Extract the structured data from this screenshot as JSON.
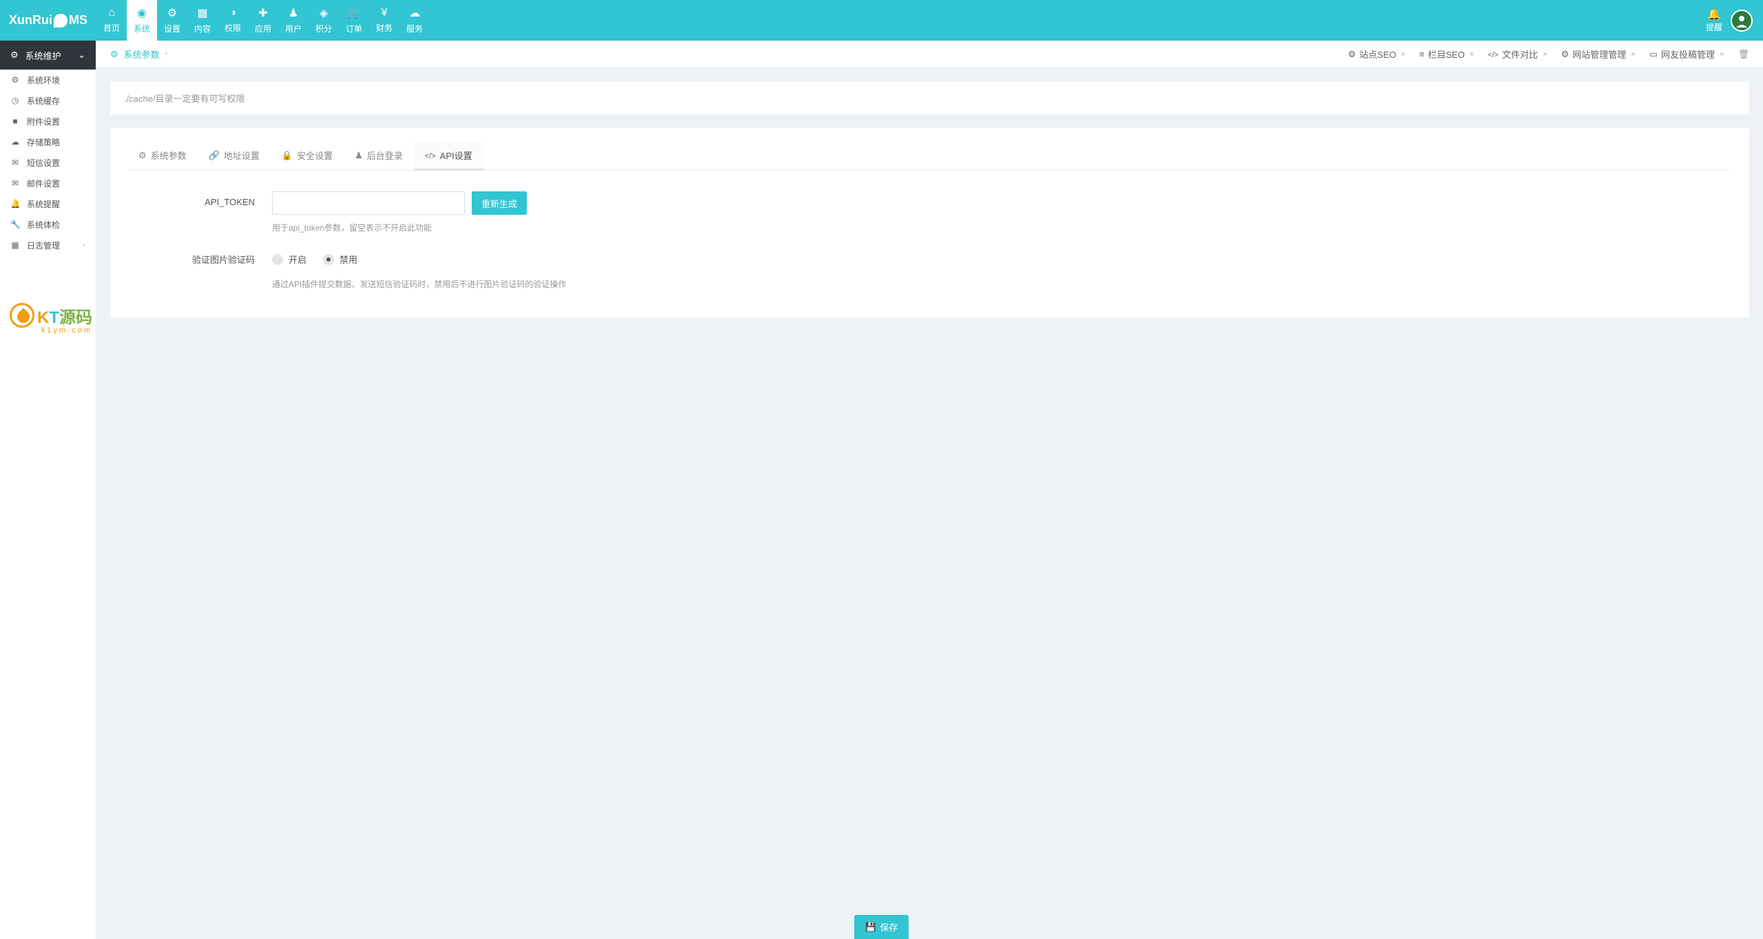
{
  "logo": {
    "prefix": "XunRui",
    "suffix": "MS"
  },
  "topNav": [
    {
      "icon": "i-home",
      "label": "首页"
    },
    {
      "icon": "i-globe",
      "label": "系统",
      "active": true
    },
    {
      "icon": "i-cogs",
      "label": "设置"
    },
    {
      "icon": "i-grid",
      "label": "内容"
    },
    {
      "icon": "i-user-shield",
      "label": "权限"
    },
    {
      "icon": "i-puzzle",
      "label": "应用"
    },
    {
      "icon": "i-user",
      "label": "用户"
    },
    {
      "icon": "i-diamond",
      "label": "积分"
    },
    {
      "icon": "i-cart",
      "label": "订单"
    },
    {
      "icon": "i-yen",
      "label": "财务"
    },
    {
      "icon": "i-cloud",
      "label": "服务"
    }
  ],
  "notify": {
    "label": "提醒"
  },
  "sidebar": {
    "header": "系统维护",
    "items": [
      {
        "icon": "i-cog",
        "label": "系统环境"
      },
      {
        "icon": "i-clock",
        "label": "系统缓存"
      },
      {
        "icon": "i-folder",
        "label": "附件设置"
      },
      {
        "icon": "i-cloud",
        "label": "存储策略"
      },
      {
        "icon": "i-envelope",
        "label": "短信设置"
      },
      {
        "icon": "i-open-envelope",
        "label": "邮件设置"
      },
      {
        "icon": "i-bell",
        "label": "系统提醒"
      },
      {
        "icon": "i-wrench",
        "label": "系统体检"
      },
      {
        "icon": "i-calendar",
        "label": "日志管理",
        "expandable": true
      }
    ]
  },
  "tabBar": {
    "left": {
      "icon": "i-cog",
      "label": "系统参数"
    },
    "right": [
      {
        "icon": "i-cog",
        "label": "站点SEO"
      },
      {
        "icon": "i-list",
        "label": "栏目SEO"
      },
      {
        "icon": "i-code",
        "label": "文件对比"
      },
      {
        "icon": "i-cog",
        "label": "网站管理管理"
      },
      {
        "icon": "i-book",
        "label": "网友投稿管理"
      }
    ]
  },
  "alert": "./cache/目录一定要有可写权限",
  "innerTabs": [
    {
      "icon": "i-cog",
      "label": "系统参数"
    },
    {
      "icon": "i-link",
      "label": "地址设置"
    },
    {
      "icon": "i-lock",
      "label": "安全设置"
    },
    {
      "icon": "i-user",
      "label": "后台登录"
    },
    {
      "icon": "i-code",
      "label": "API设置",
      "active": true
    }
  ],
  "form": {
    "apiToken": {
      "label": "API_TOKEN",
      "value": "",
      "button": "重新生成",
      "help": "用于api_token参数，留空表示不开启此功能"
    },
    "captcha": {
      "label": "验证图片验证码",
      "options": {
        "on": "开启",
        "off": "禁用"
      },
      "selected": "off",
      "help": "通过API插件提交数据、发送短信验证码时，禁用后不进行图片验证码的验证操作"
    }
  },
  "saveButton": "保存",
  "watermark": {
    "k": "K",
    "t": "T",
    "cn": "源码",
    "sub": "k1ym.com"
  }
}
